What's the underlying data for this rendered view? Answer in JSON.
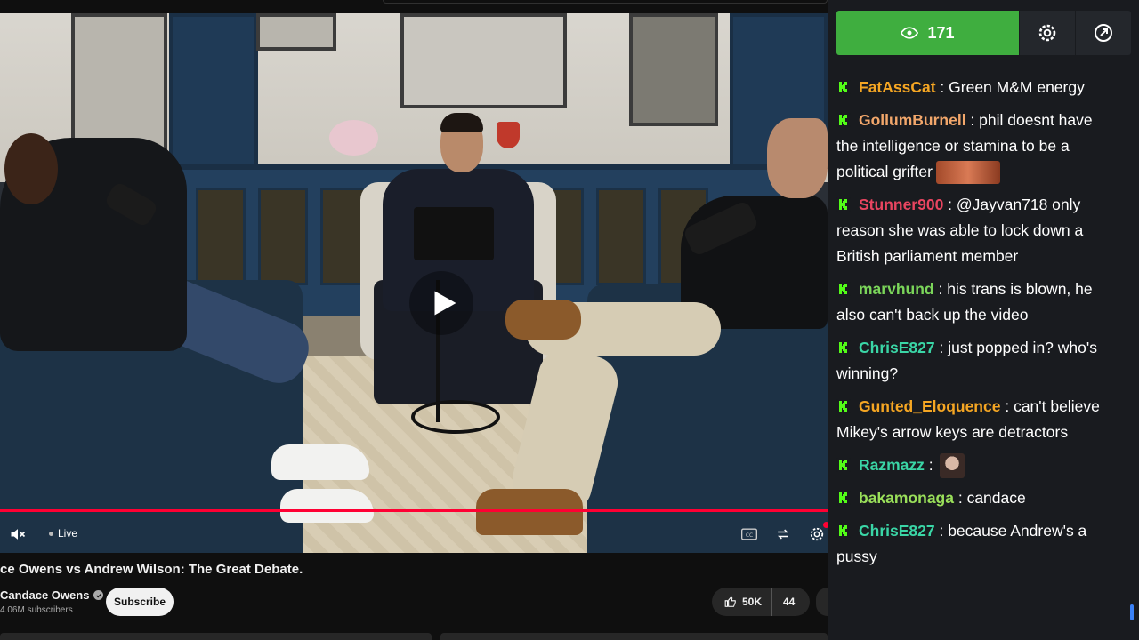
{
  "video": {
    "live_label": "Live",
    "progress_fraction": 1.0,
    "title": "ce Owens vs Andrew Wilson: The Great Debate.",
    "channel_name": "Candace Owens",
    "subscriber_count": "4.06M subscribers",
    "subscribe_label": "Subscribe",
    "like_count": "50K",
    "dislike_count": "44",
    "icons": [
      "play-icon",
      "mute-icon",
      "cc-icon",
      "loop-icon",
      "settings-gear-icon",
      "like-icon",
      "verified-icon"
    ]
  },
  "chat": {
    "viewer_count": "171",
    "accent_color": "#3fae3f",
    "icons": [
      "eye-icon",
      "gear-icon",
      "popout-icon",
      "kick-badge-icon"
    ],
    "messages": [
      {
        "user": "FatAssCat",
        "color": "#f5a623",
        "text": "Green M&M energy"
      },
      {
        "user": "GollumBurnell",
        "color": "#f2a76b",
        "text": "phil doesnt have the intelligence or stamina to be a political grifter",
        "emote": "emote-1"
      },
      {
        "user": "Stunner900",
        "color": "#e94560",
        "text": "@Jayvan718 only reason she was able to lock down a British parliament member"
      },
      {
        "user": "marvhund",
        "color": "#7bd65a",
        "text": "his trans is blown, he also can't back up the video"
      },
      {
        "user": "ChrisE827",
        "color": "#3ad6a6",
        "text": "just popped in? who's winning?"
      },
      {
        "user": "Gunted_Eloquence",
        "color": "#f5a623",
        "text": "can't believe Mikey's arrow keys are detractors"
      },
      {
        "user": "Razmazz",
        "color": "#3ad6a6",
        "text": "",
        "emote": "emote-2"
      },
      {
        "user": "bakamonaga",
        "color": "#9ae05a",
        "text": "candace"
      },
      {
        "user": "ChrisE827",
        "color": "#3ad6a6",
        "text": "because Andrew's a pussy"
      }
    ]
  }
}
